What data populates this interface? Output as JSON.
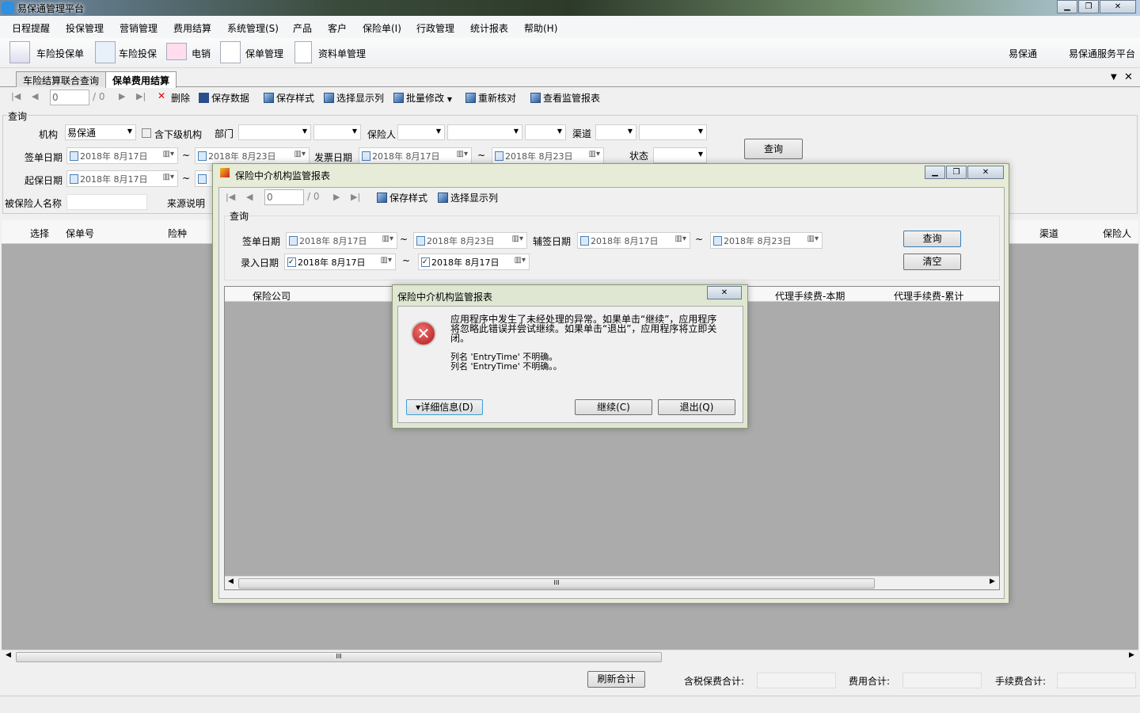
{
  "app": {
    "title": "易保通管理平台"
  },
  "menu": [
    "日程提醒",
    "投保管理",
    "营销管理",
    "费用结算",
    "系统管理(S)",
    "产品",
    "客户",
    "保险单(I)",
    "行政管理",
    "统计报表",
    "帮助(H)"
  ],
  "toolbar": {
    "items": [
      "车险投保单",
      "车险投保",
      "电销",
      "保单管理",
      "资料单管理"
    ],
    "right": [
      "易保通",
      "易保通服务平台"
    ]
  },
  "tabs": [
    "车险结算联合查询",
    "保单费用结算"
  ],
  "pager": {
    "page": "0",
    "total": "/ 0"
  },
  "actions": [
    "删除",
    "保存数据",
    "保存样式",
    "选择显示列",
    "批量修改",
    "重新核对",
    "查看监管报表"
  ],
  "query": {
    "legend": "查询",
    "org_label": "机构",
    "org_value": "易保通",
    "include_sub": "含下级机构",
    "dept_label": "部门",
    "insurer_label": "保险人",
    "channel_label": "渠道",
    "sign_date_label": "签单日期",
    "invoice_date_label": "发票日期",
    "status_label": "状态",
    "start_date_label": "起保日期",
    "insured_name_label": "被保险人名称",
    "source_label": "来源说明",
    "search": "查询",
    "d1": "2018年 8月17日",
    "d2": "2018年 8月23日",
    "tilde": "~"
  },
  "grid": {
    "columns": [
      "选择",
      "保单号",
      "险种"
    ],
    "right_columns": [
      "渠道",
      "保险人"
    ]
  },
  "footer": {
    "refresh": "刷新合计",
    "tax_premium": "含税保费合计:",
    "fee_total": "费用合计:",
    "commission_total": "手续费合计:"
  },
  "report": {
    "title": "保险中介机构监管报表",
    "pager_page": "0",
    "pager_total": "/ 0",
    "actions": [
      "保存样式",
      "选择显示列"
    ],
    "legend": "查询",
    "sign_date_label": "签单日期",
    "co_sign_label": "辅签日期",
    "entry_date_label": "录入日期",
    "d1": "2018年 8月17日",
    "d2": "2018年 8月23日",
    "search": "查询",
    "clear": "清空",
    "columns": [
      "保险公司",
      "代理手续费-本期",
      "代理手续费-累计"
    ],
    "scroll_mark": "III"
  },
  "error": {
    "title": "保险中介机构监管报表",
    "message": "应用程序中发生了未经处理的异常。如果单击“继续”，应用程序将忽略此错误并尝试继续。如果单击“退出”，应用程序将立即关闭。",
    "detail1": "列名 'EntryTime' 不明确。",
    "detail2": "列名 'EntryTime' 不明确。。",
    "details_btn": "▾详细信息(D)",
    "continue_btn": "继续(C)",
    "quit_btn": "退出(Q)"
  },
  "main_scroll_mark": "III"
}
